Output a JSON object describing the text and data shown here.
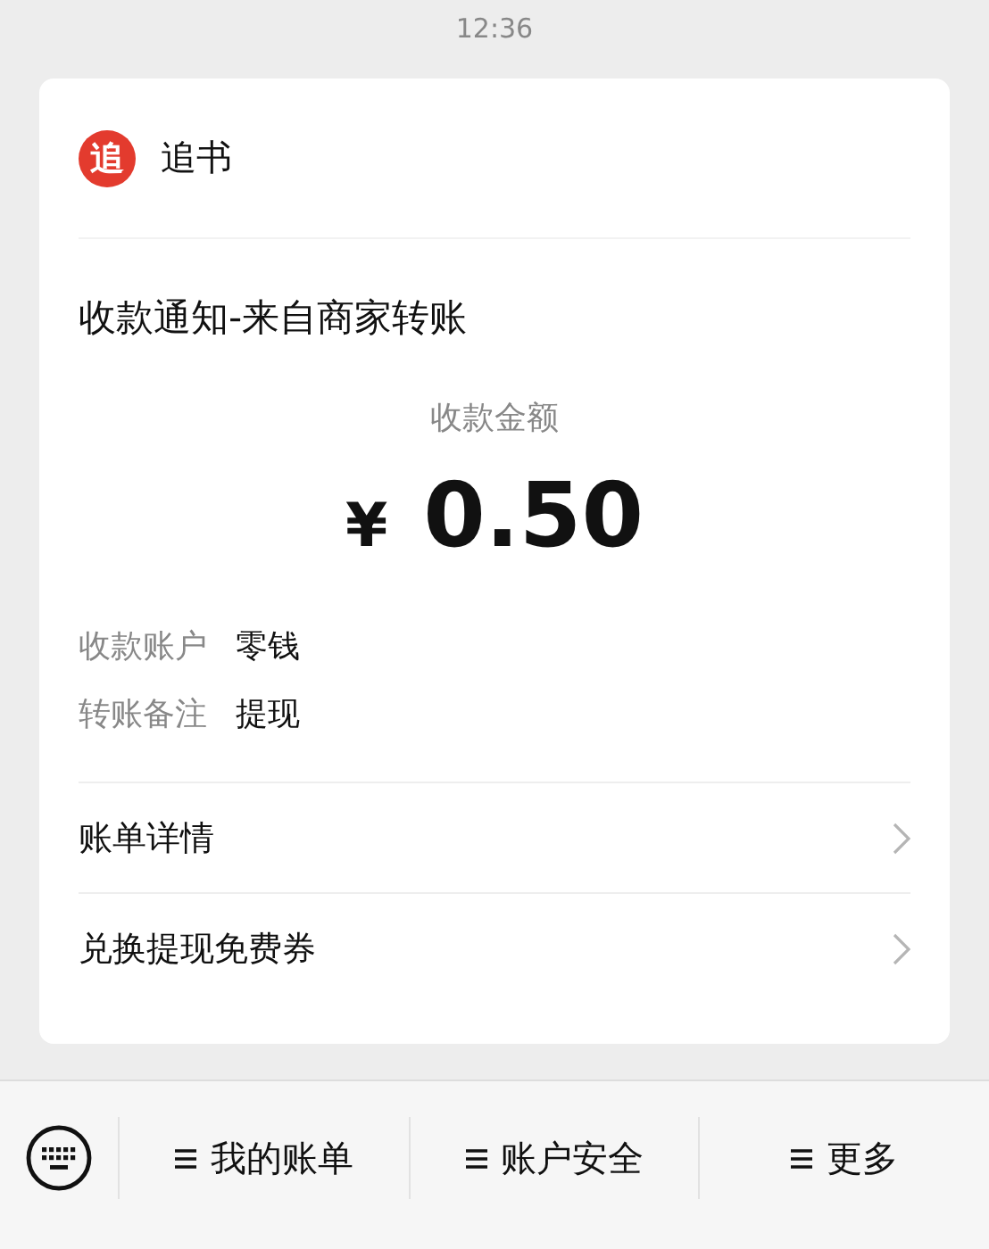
{
  "status_bar": {
    "time": "12:36"
  },
  "card": {
    "app": {
      "logo_text": "追",
      "name": "追书"
    },
    "title": "收款通知-来自商家转账",
    "amount_label": "收款金额",
    "currency": "¥",
    "amount": "0.50",
    "details": [
      {
        "label": "收款账户",
        "value": "零钱"
      },
      {
        "label": "转账备注",
        "value": "提现"
      }
    ],
    "links": [
      {
        "label": "账单详情"
      },
      {
        "label": "兑换提现免费券"
      }
    ]
  },
  "menu_bar": {
    "items": [
      {
        "label": "我的账单"
      },
      {
        "label": "账户安全"
      },
      {
        "label": "更多"
      }
    ]
  }
}
